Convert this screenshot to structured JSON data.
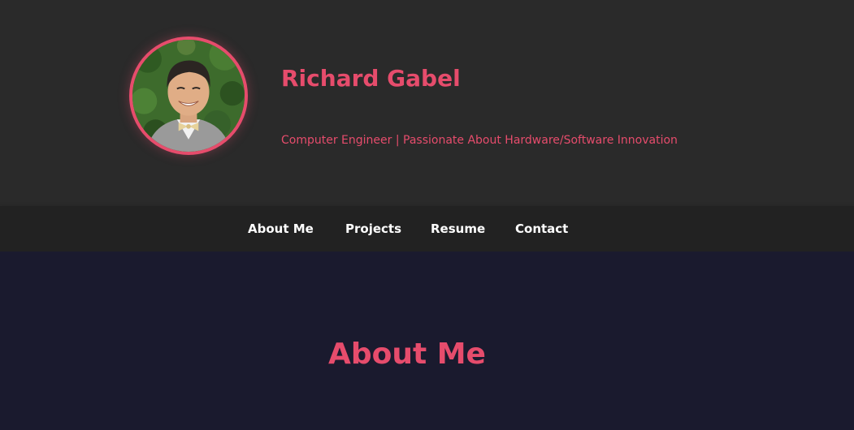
{
  "header": {
    "name": "Richard Gabel",
    "tagline": "Computer Engineer | Passionate About Hardware/Software Innovation"
  },
  "nav": {
    "items": [
      {
        "label": "About Me"
      },
      {
        "label": "Projects"
      },
      {
        "label": "Resume"
      },
      {
        "label": "Contact"
      }
    ]
  },
  "main": {
    "section_title": "About Me"
  },
  "colors": {
    "accent": "#e64c6c",
    "hero_bg": "#2a2a2a",
    "nav_bg": "#222222",
    "main_bg": "#1a1a2e",
    "nav_text": "#ffffff"
  }
}
